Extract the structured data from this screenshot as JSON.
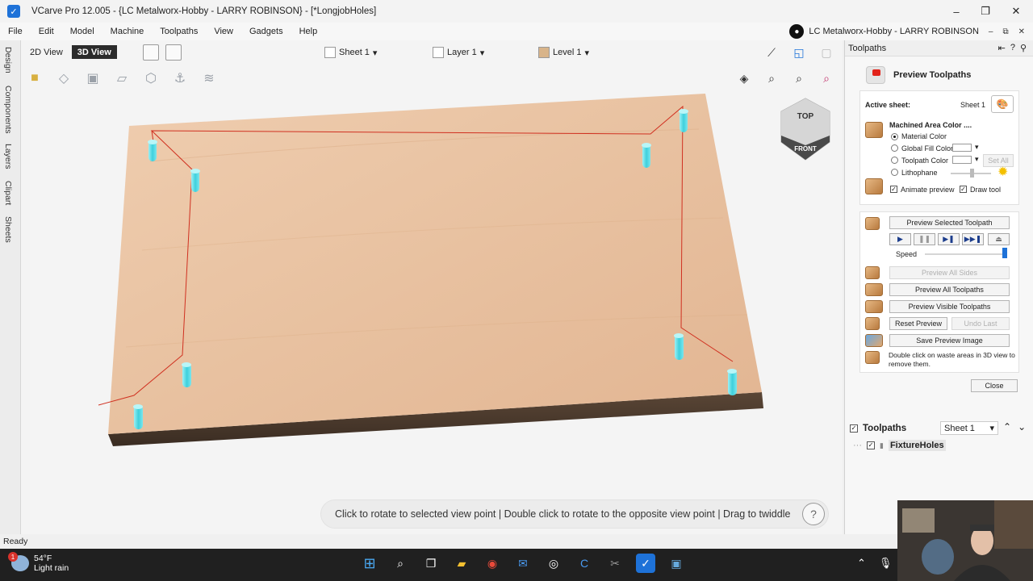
{
  "window": {
    "title": "VCarve Pro 12.005 - {LC Metalworx-Hobby - LARRY ROBINSON} - [*LongjobHoles]",
    "minimize": "–",
    "maximize": "❐",
    "close": "✕"
  },
  "menu": [
    "File",
    "Edit",
    "Model",
    "Machine",
    "Toolpaths",
    "View",
    "Gadgets",
    "Help"
  ],
  "user": {
    "name": "LC Metalworx-Hobby - LARRY ROBINSON",
    "ctrl_min": "–",
    "ctrl_restore": "⧉",
    "ctrl_close": "✕"
  },
  "left_tabs": [
    "Design",
    "Components",
    "Layers",
    "Clipart",
    "Sheets"
  ],
  "viewport": {
    "view_tabs": [
      "2D View",
      "3D View"
    ],
    "active_view": "3D View",
    "sheet_selector": "Sheet 1",
    "layer_selector": "Layer 1",
    "level_selector": "Level 1",
    "viewcube": {
      "top": "TOP",
      "front": "FRONT"
    },
    "hint": "Click to rotate to selected view point | Double click to rotate to the opposite view point | Drag to twiddle",
    "help": "?"
  },
  "panel": {
    "header": "Toolpaths",
    "title": "Preview Toolpaths",
    "active_sheet_label": "Active sheet:",
    "active_sheet_value": "Sheet 1",
    "machined_area_label": "Machined Area Color ....",
    "radio_options": [
      {
        "label": "Material Color",
        "selected": true
      },
      {
        "label": "Global Fill Color",
        "selected": false
      },
      {
        "label": "Toolpath Color",
        "selected": false
      },
      {
        "label": "Lithophane",
        "selected": false
      }
    ],
    "set_all": "Set All",
    "animate_preview": "Animate preview",
    "draw_tool": "Draw tool",
    "preview_selected": "Preview Selected Toolpath",
    "speed_label": "Speed",
    "preview_all_sides": "Preview All Sides",
    "preview_all_toolpaths": "Preview All Toolpaths",
    "preview_visible_toolpaths": "Preview Visible Toolpaths",
    "reset_preview": "Reset Preview",
    "undo_last": "Undo Last",
    "save_preview_image": "Save Preview Image",
    "waste_hint": "Double click on waste areas in 3D view to remove them.",
    "close": "Close"
  },
  "toolpaths_list": {
    "title": "Toolpaths",
    "sheet": "Sheet 1",
    "items": [
      {
        "name": "FixtureHoles",
        "checked": true
      }
    ]
  },
  "status": "Ready",
  "weather": {
    "temp": "54°F",
    "desc": "Light rain",
    "badge": "1"
  },
  "colors": {
    "wood": "#e8c2a0",
    "toolpath": "#d03020",
    "holes": "#4fd8e0",
    "accent": "#1e72d8"
  }
}
